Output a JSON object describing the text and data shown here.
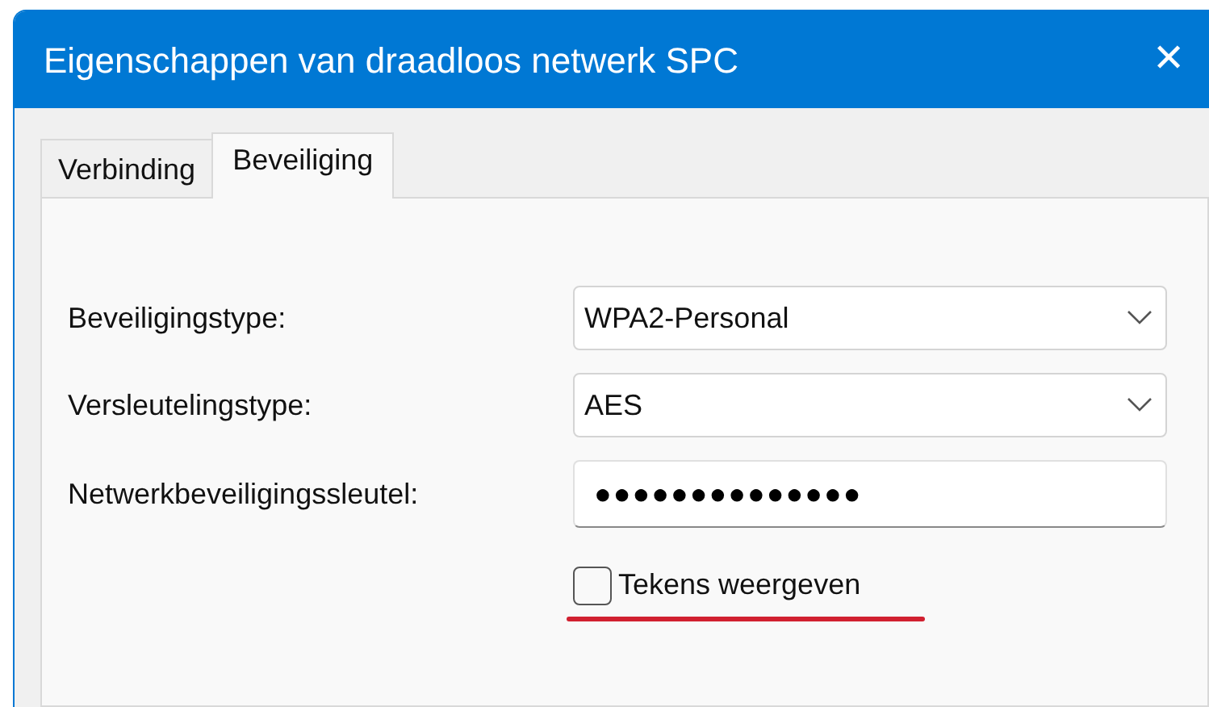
{
  "window": {
    "title": "Eigenschappen van draadloos netwerk SPC",
    "close": "✕"
  },
  "tabs": [
    {
      "label": "Verbinding",
      "selected": false
    },
    {
      "label": "Beveiliging",
      "selected": true
    }
  ],
  "fields": [
    {
      "kind": "dropdown",
      "label": "Beveiligingstype:",
      "value": "WPA2-Personal"
    },
    {
      "kind": "dropdown",
      "label": "Versleutelingstype:",
      "value": "AES"
    },
    {
      "kind": "password",
      "label": "Netwerkbeveiligingssleutel:",
      "value": "●●●●●●●●●●●●●●"
    }
  ],
  "show_characters": {
    "label": "Tekens weergeven",
    "checked": false
  }
}
